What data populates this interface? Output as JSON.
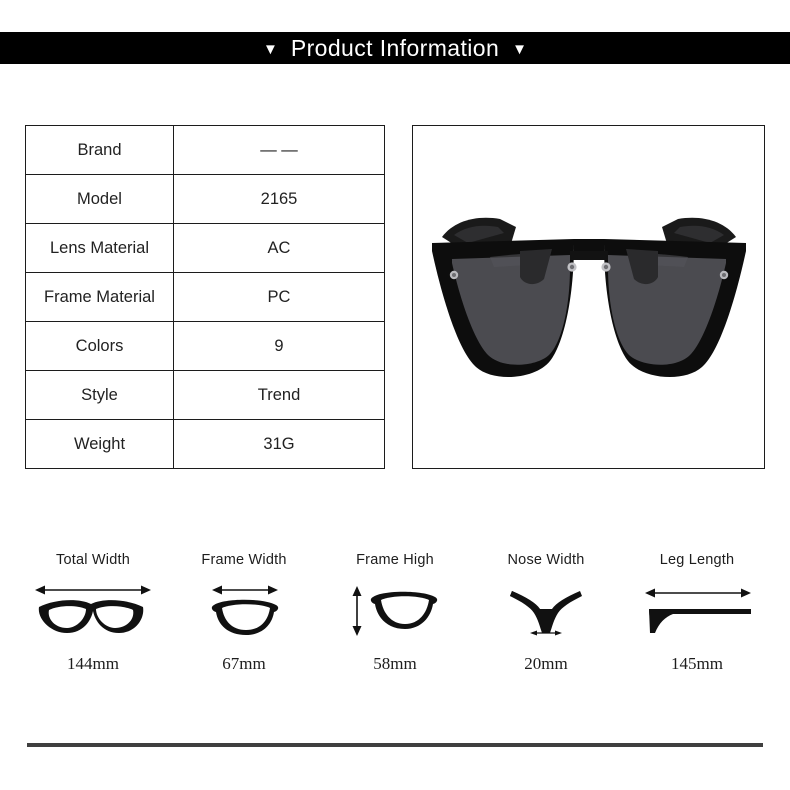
{
  "header": {
    "title": "Product Information",
    "left_marker": "▼",
    "right_marker": "▼",
    "background_color": "#000000",
    "text_color": "#ffffff"
  },
  "spec_table": {
    "rows": [
      {
        "key": "Brand",
        "value": "— —"
      },
      {
        "key": "Model",
        "value": "2165"
      },
      {
        "key": "Lens Material",
        "value": "AC"
      },
      {
        "key": "Frame Material",
        "value": "PC"
      },
      {
        "key": "Colors",
        "value": "9"
      },
      {
        "key": "Style",
        "value": "Trend"
      },
      {
        "key": "Weight",
        "value": "31G"
      }
    ],
    "border_color": "#1c1c1c"
  },
  "product_photo": {
    "alt": "black cat-eye sunglasses front view",
    "frame_color": "#101010",
    "lens_color": "#4b4b50",
    "rivet_color": "#b9b9bd"
  },
  "measurements": [
    {
      "label": "Total Width",
      "value": "144mm",
      "icon": "glasses-total-width-icon",
      "arrow": "horizontal"
    },
    {
      "label": "Frame Width",
      "value": "67mm",
      "icon": "lens-frame-width-icon",
      "arrow": "horizontal"
    },
    {
      "label": "Frame High",
      "value": "58mm",
      "icon": "lens-frame-height-icon",
      "arrow": "vertical"
    },
    {
      "label": "Nose Width",
      "value": "20mm",
      "icon": "nose-bridge-icon",
      "arrow": "horizontal"
    },
    {
      "label": "Leg Length",
      "value": "145mm",
      "icon": "temple-arm-icon",
      "arrow": "horizontal"
    }
  ],
  "footer": {
    "rule_color": "#3f3f3f"
  }
}
